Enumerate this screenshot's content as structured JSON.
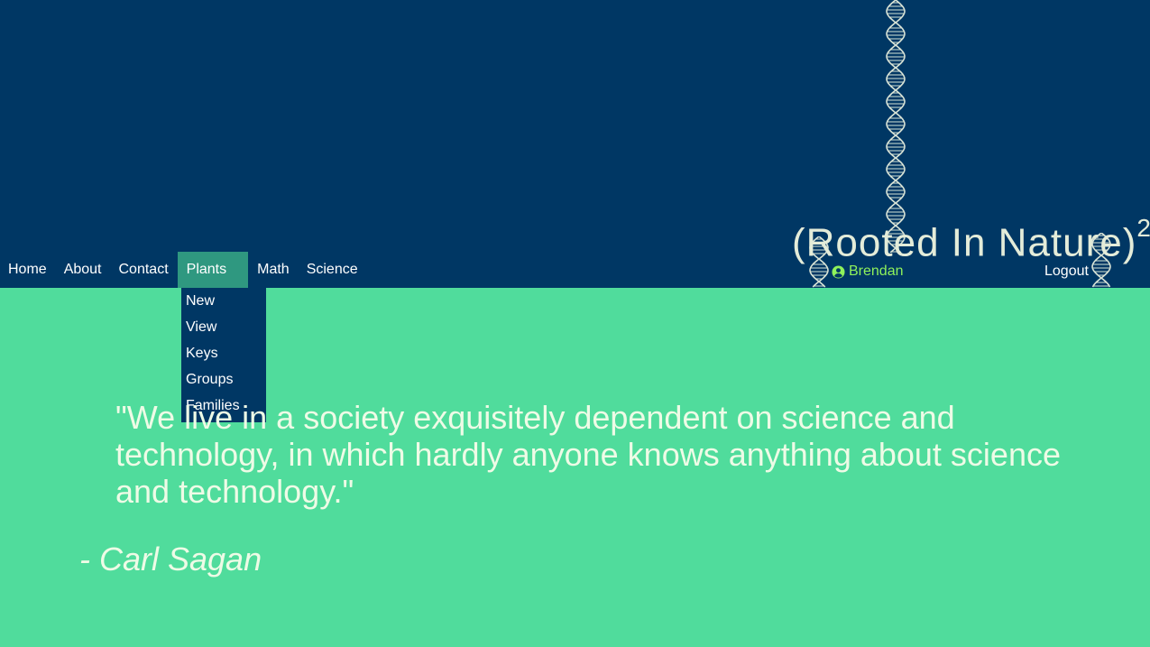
{
  "nav": {
    "items": [
      {
        "label": "Home"
      },
      {
        "label": "About"
      },
      {
        "label": "Contact"
      },
      {
        "label": "Plants",
        "active": true
      },
      {
        "label": "Math"
      },
      {
        "label": "Science"
      }
    ]
  },
  "dropdown": {
    "items": [
      "New",
      "View",
      "Keys",
      "Groups",
      "Families"
    ]
  },
  "logo": {
    "text": "(Rooted In Nature)",
    "superscript": "2"
  },
  "user": {
    "name": "Brendan",
    "icon": "user-circle-icon"
  },
  "logout_label": "Logout",
  "quote": {
    "text": "\"We live in a society exquisitely dependent on science and technology, in which hardly anyone knows anything about science and technology.\"",
    "author": "- Carl Sagan"
  },
  "colors": {
    "header": "#003764",
    "page": "#50dc9c",
    "active_tab": "#2f9880",
    "user": "#8ff25b",
    "quote_text": "#eefbe6"
  }
}
